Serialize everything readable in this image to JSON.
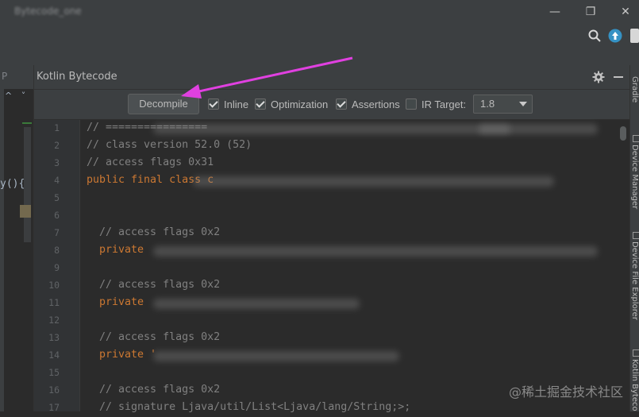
{
  "window": {
    "title": "Bytecode_one",
    "controls": {
      "minimize": "—",
      "maximize": "❐",
      "close": "✕"
    }
  },
  "toolbar": {
    "icons": [
      "search-icon",
      "update-icon"
    ]
  },
  "left_editor": {
    "header_char": "P",
    "arrows": "^ ˅",
    "code_fragment": "y(){"
  },
  "panel": {
    "title": "Kotlin Bytecode",
    "icons": [
      "gear-icon",
      "minimize-icon"
    ]
  },
  "options": {
    "decompile_label": "Decompile",
    "inline": {
      "label": "Inline",
      "checked": true
    },
    "optimization": {
      "label": "Optimization",
      "checked": true
    },
    "assertions": {
      "label": "Assertions",
      "checked": true
    },
    "ir_target": {
      "label": "IR Target:",
      "checked": false
    },
    "target_select": {
      "value": "1.8"
    }
  },
  "code_lines": [
    {
      "n": "1",
      "text": "// ================",
      "cls": "cm"
    },
    {
      "n": "2",
      "text": "// class version 52.0 (52)",
      "cls": "cm"
    },
    {
      "n": "3",
      "text": "// access flags 0x31",
      "cls": "cm"
    },
    {
      "n": "4",
      "text": "public final class c",
      "cls": "kw"
    },
    {
      "n": "5",
      "text": "",
      "cls": ""
    },
    {
      "n": "6",
      "text": "",
      "cls": ""
    },
    {
      "n": "7",
      "text": "  // access flags 0x2",
      "cls": "cm"
    },
    {
      "n": "8",
      "text": "  private",
      "cls": "kw"
    },
    {
      "n": "9",
      "text": "",
      "cls": ""
    },
    {
      "n": "10",
      "text": "  // access flags 0x2",
      "cls": "cm"
    },
    {
      "n": "11",
      "text": "  private",
      "cls": "kw"
    },
    {
      "n": "12",
      "text": "",
      "cls": ""
    },
    {
      "n": "13",
      "text": "  // access flags 0x2",
      "cls": "cm"
    },
    {
      "n": "14",
      "text": "  private '",
      "cls": "kw"
    },
    {
      "n": "15",
      "text": "",
      "cls": ""
    },
    {
      "n": "16",
      "text": "  // access flags 0x2",
      "cls": "cm"
    },
    {
      "n": "17",
      "text": "  // signature Ljava/util/List<Ljava/lang/String;>;",
      "cls": "cm"
    }
  ],
  "right_tabs": {
    "gradle": "Gradle",
    "device_manager": "Device Manager",
    "device_file_explorer": "Device File Explorer",
    "kotlin_bytecode": "Kotlin Byteco"
  },
  "watermark": "@稀土掘金技术社区",
  "colors": {
    "annotation_arrow": "#e040e0",
    "comment": "#808080",
    "keyword": "#cc7832",
    "background": "#2b2b2b",
    "chrome": "#3c3f41"
  }
}
